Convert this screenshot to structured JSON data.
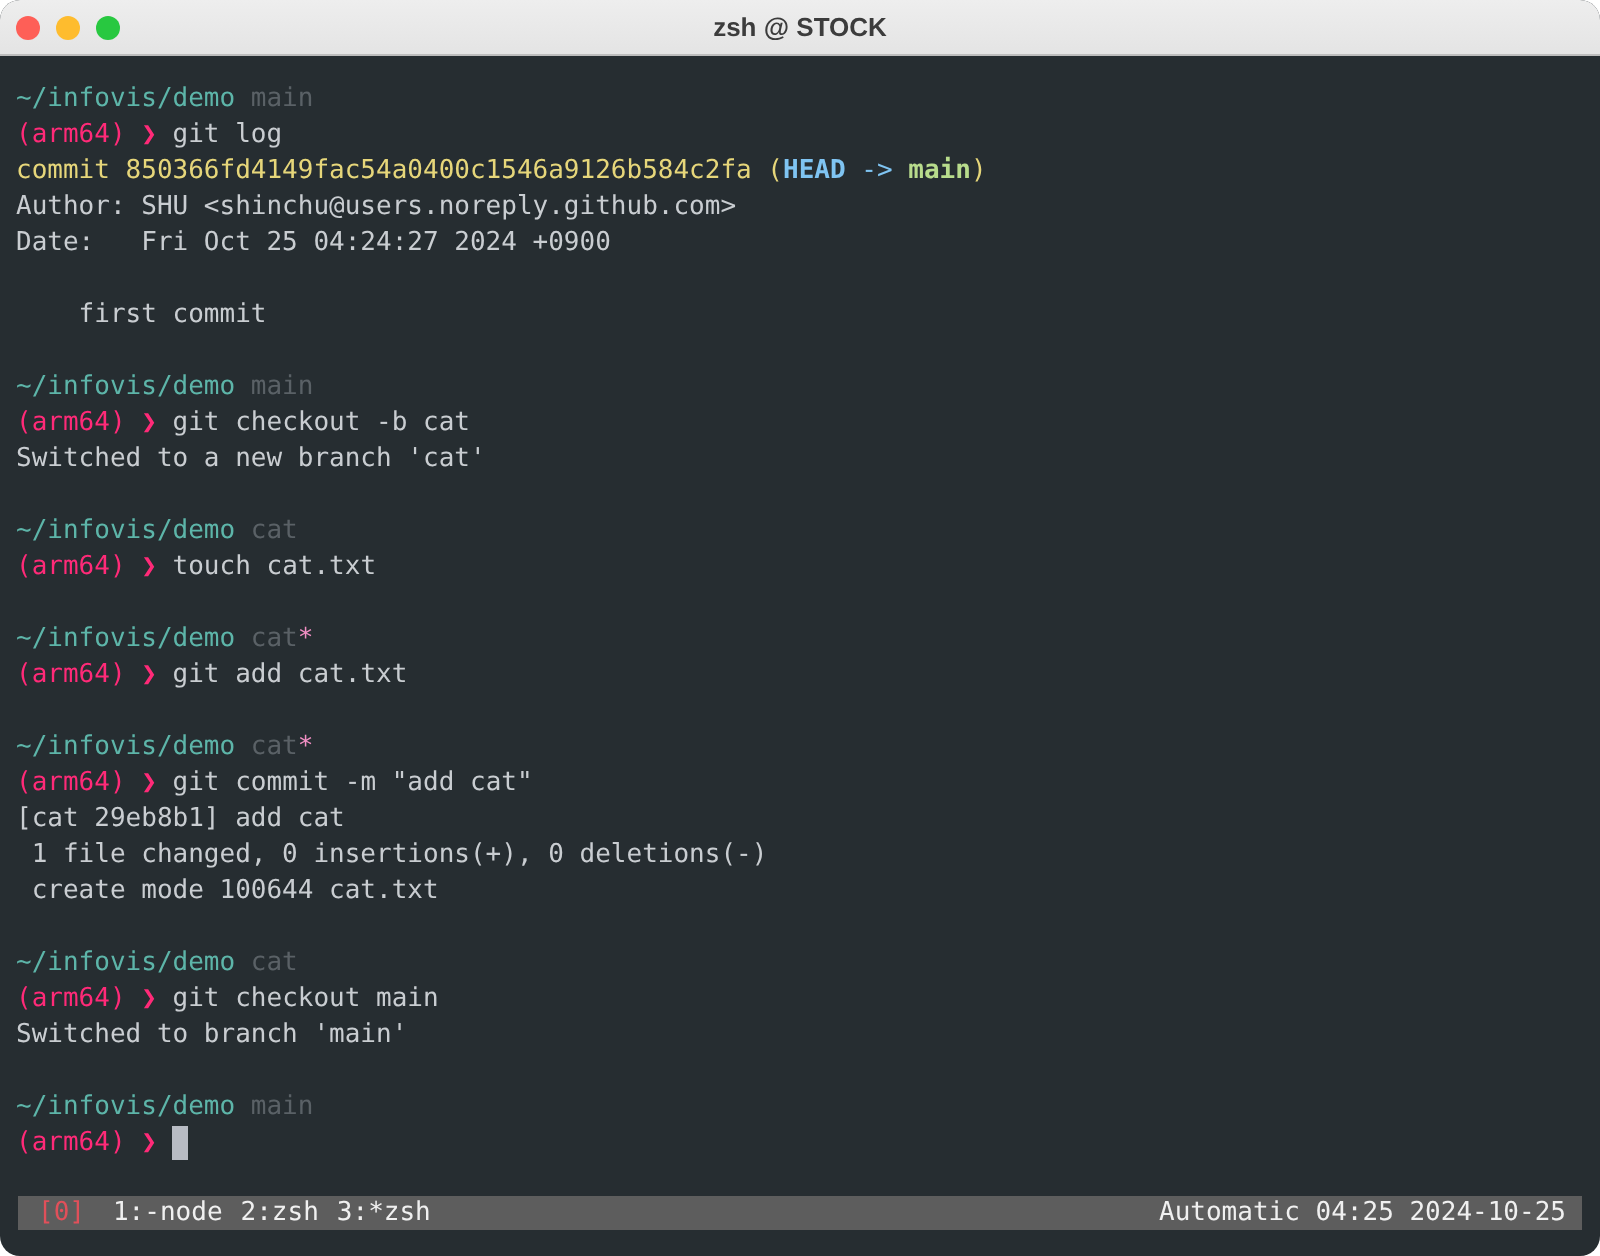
{
  "window": {
    "title": "zsh @ STOCK"
  },
  "blocks": [
    {
      "path": "~/infovis/demo",
      "branch": "main",
      "prompt_env": "(arm64)",
      "prompt_symbol": "❯",
      "command": "git log",
      "output": [
        {
          "kind": "text",
          "segments": [
            {
              "text": "commit 850366fd4149fac54a0400c1546a9126b584c2fa (",
              "kind": "commit"
            },
            {
              "text": "HEAD",
              "kind": "head-ref"
            },
            {
              "text": " -> ",
              "kind": "ref-arrow"
            },
            {
              "text": "main",
              "kind": "branch-ref"
            },
            {
              "text": ")",
              "kind": "commit"
            }
          ]
        },
        {
          "kind": "text",
          "segments": [
            {
              "text": "Author: SHU <shinchu@users.noreply.github.com>",
              "kind": "plain"
            }
          ]
        },
        {
          "kind": "text",
          "segments": [
            {
              "text": "Date:   Fri Oct 25 04:24:27 2024 +0900",
              "kind": "plain"
            }
          ]
        },
        {
          "kind": "blank"
        },
        {
          "kind": "text",
          "segments": [
            {
              "text": "    first commit",
              "kind": "plain"
            }
          ]
        }
      ]
    },
    {
      "path": "~/infovis/demo",
      "branch": "main",
      "prompt_env": "(arm64)",
      "prompt_symbol": "❯",
      "command": "git checkout -b cat",
      "output": [
        {
          "kind": "text",
          "segments": [
            {
              "text": "Switched to a new branch 'cat'",
              "kind": "plain"
            }
          ]
        }
      ]
    },
    {
      "path": "~/infovis/demo",
      "branch": "cat",
      "prompt_env": "(arm64)",
      "prompt_symbol": "❯",
      "command": "touch cat.txt"
    },
    {
      "path": "~/infovis/demo",
      "branch": "cat",
      "dirty_mark": "*",
      "prompt_env": "(arm64)",
      "prompt_symbol": "❯",
      "command": "git add cat.txt"
    },
    {
      "path": "~/infovis/demo",
      "branch": "cat",
      "dirty_mark": "*",
      "prompt_env": "(arm64)",
      "prompt_symbol": "❯",
      "command": "git commit -m \"add cat\"",
      "output": [
        {
          "kind": "text",
          "segments": [
            {
              "text": "[cat 29eb8b1] add cat",
              "kind": "plain"
            }
          ]
        },
        {
          "kind": "text",
          "segments": [
            {
              "text": " 1 file changed, 0 insertions(+), 0 deletions(-)",
              "kind": "plain"
            }
          ]
        },
        {
          "kind": "text",
          "segments": [
            {
              "text": " create mode 100644 cat.txt",
              "kind": "plain"
            }
          ]
        }
      ]
    },
    {
      "path": "~/infovis/demo",
      "branch": "cat",
      "prompt_env": "(arm64)",
      "prompt_symbol": "❯",
      "command": "git checkout main",
      "output": [
        {
          "kind": "text",
          "segments": [
            {
              "text": "Switched to branch 'main'",
              "kind": "plain"
            }
          ]
        }
      ]
    },
    {
      "path": "~/infovis/demo",
      "branch": "main",
      "prompt_env": "(arm64)",
      "prompt_symbol": "❯",
      "cursor": true
    }
  ],
  "status_bar": {
    "session": "[0]",
    "windows": [
      "1:-node",
      "2:zsh",
      "3:*zsh"
    ],
    "right": "Automatic 04:25 2024-10-25"
  }
}
